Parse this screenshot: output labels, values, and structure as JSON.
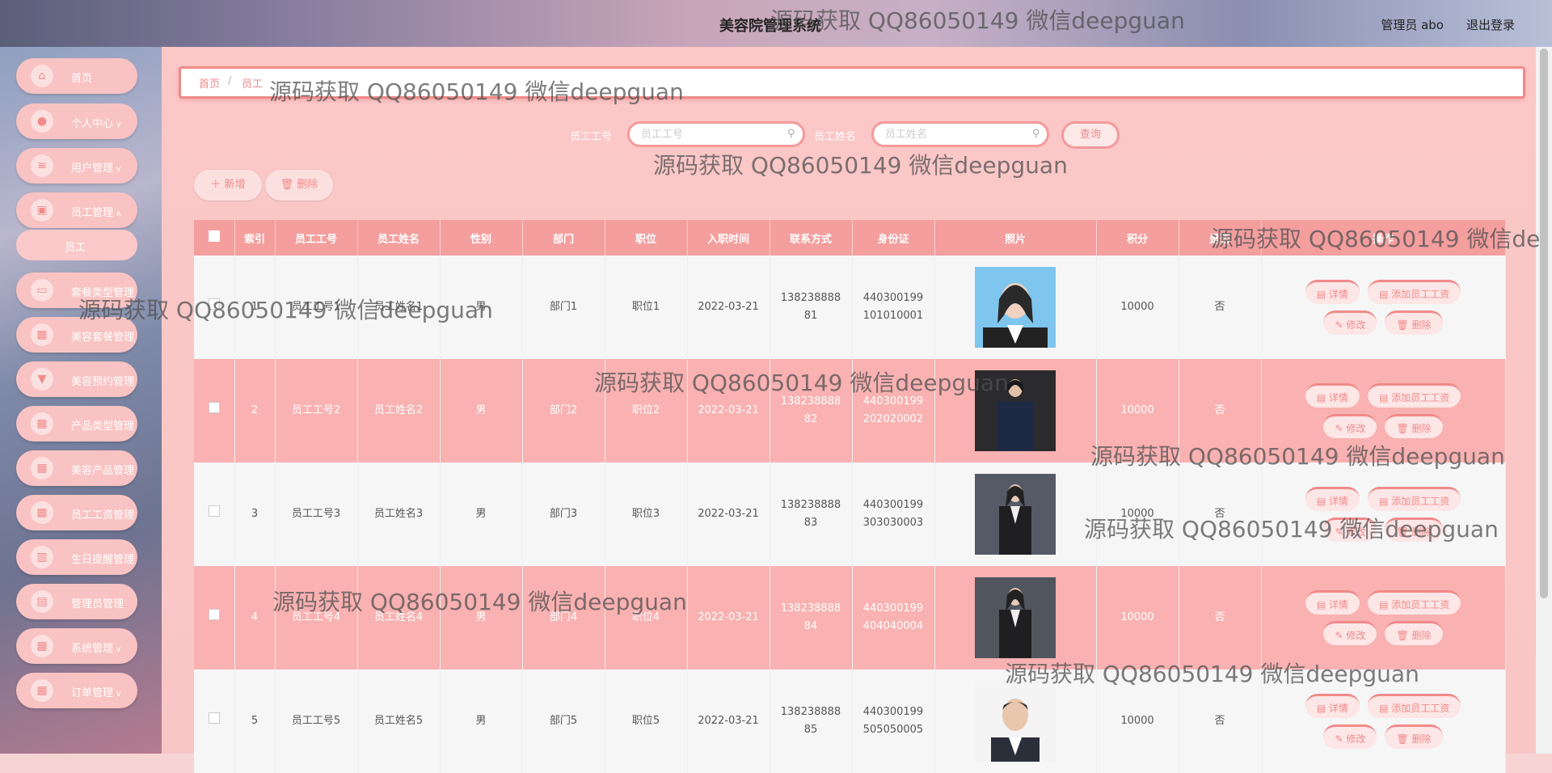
{
  "header": {
    "title": "美容院管理系统",
    "user": "管理员 abo",
    "logout": "退出登录"
  },
  "sidebar": {
    "items": [
      {
        "label": "首页",
        "icon": "home-icon"
      },
      {
        "label": "个人中心",
        "icon": "user-icon",
        "chevron": true
      },
      {
        "label": "用户管理",
        "icon": "list-icon",
        "chevron": true
      },
      {
        "label": "员工管理",
        "icon": "staff-icon",
        "chevron": true
      },
      {
        "label": "套餐类型管理",
        "icon": "monitor-icon"
      },
      {
        "label": "美容套餐管理",
        "icon": "grid-icon"
      },
      {
        "label": "美容预约管理",
        "icon": "pin-icon"
      },
      {
        "label": "产品类型管理",
        "icon": "grid-icon"
      },
      {
        "label": "美容产品管理",
        "icon": "grid-icon"
      },
      {
        "label": "员工工资管理",
        "icon": "grid-icon"
      },
      {
        "label": "生日提醒管理",
        "icon": "cake-icon"
      },
      {
        "label": "管理员管理",
        "icon": "clipboard-icon"
      },
      {
        "label": "系统管理",
        "icon": "grid-icon",
        "chevron": true
      },
      {
        "label": "订单管理",
        "icon": "grid-icon",
        "chevron": true
      }
    ],
    "sub_item": "员工"
  },
  "breadcrumb": {
    "home": "首页",
    "sep": "/",
    "current": "员工"
  },
  "search": {
    "id_label": "员工工号",
    "id_placeholder": "员工工号",
    "name_label": "员工姓名",
    "name_placeholder": "员工姓名",
    "query": "查询"
  },
  "toolbar": {
    "add": "＋ 新增",
    "delete": "🗑 删除"
  },
  "table": {
    "headers": [
      "索引",
      "员工工号",
      "员工姓名",
      "性别",
      "部门",
      "职位",
      "入职时间",
      "联系方式",
      "身份证",
      "照片",
      "积分",
      "是否",
      "操作"
    ],
    "rows": [
      {
        "idx": "1",
        "id": "员工工号1",
        "name": "员工姓名1",
        "sex": "男",
        "dept": "部门1",
        "pos": "职位1",
        "date": "2022-03-21",
        "phone1": "138238888",
        "phone2": "81",
        "idcard1": "440300199",
        "idcard2": "101010001",
        "points": "10000",
        "flag": "否"
      },
      {
        "idx": "2",
        "id": "员工工号2",
        "name": "员工姓名2",
        "sex": "男",
        "dept": "部门2",
        "pos": "职位2",
        "date": "2022-03-21",
        "phone1": "138238888",
        "phone2": "82",
        "idcard1": "440300199",
        "idcard2": "202020002",
        "points": "10000",
        "flag": "否"
      },
      {
        "idx": "3",
        "id": "员工工号3",
        "name": "员工姓名3",
        "sex": "男",
        "dept": "部门3",
        "pos": "职位3",
        "date": "2022-03-21",
        "phone1": "138238888",
        "phone2": "83",
        "idcard1": "440300199",
        "idcard2": "303030003",
        "points": "10000",
        "flag": "否"
      },
      {
        "idx": "4",
        "id": "员工工号4",
        "name": "员工姓名4",
        "sex": "男",
        "dept": "部门4",
        "pos": "职位4",
        "date": "2022-03-21",
        "phone1": "138238888",
        "phone2": "84",
        "idcard1": "440300199",
        "idcard2": "404040004",
        "points": "10000",
        "flag": "否"
      },
      {
        "idx": "5",
        "id": "员工工号5",
        "name": "员工姓名5",
        "sex": "男",
        "dept": "部门5",
        "pos": "职位5",
        "date": "2022-03-21",
        "phone1": "138238888",
        "phone2": "85",
        "idcard1": "440300199",
        "idcard2": "505050005",
        "points": "10000",
        "flag": "否"
      }
    ],
    "ops": {
      "detail": "详情",
      "add_salary": "添加员工工资",
      "edit": "修改",
      "delete": "删除"
    }
  },
  "watermarks": [
    "源码获取 QQ86050149 微信deepguan",
    "源码获取 QQ86050149 微信deepguan",
    "源码获取 QQ86050149 微信deepguan",
    "源码获取 QQ86050149 微信de",
    "源码获取 QQ86050149 微信deepguan",
    "源码获取 QQ86050149 微信deepguan",
    "源码获取 QQ86050149 微信deepguan",
    "源码获取 QQ86050149 微信deepguan",
    "源码获取 QQ86050149 微信deepguan",
    "源码获取 QQ86050149 微信deepguan"
  ],
  "colors": {
    "accent": "#f08a8a",
    "header_row": "#f49e9e",
    "alt_row": "#f9b1b1"
  }
}
